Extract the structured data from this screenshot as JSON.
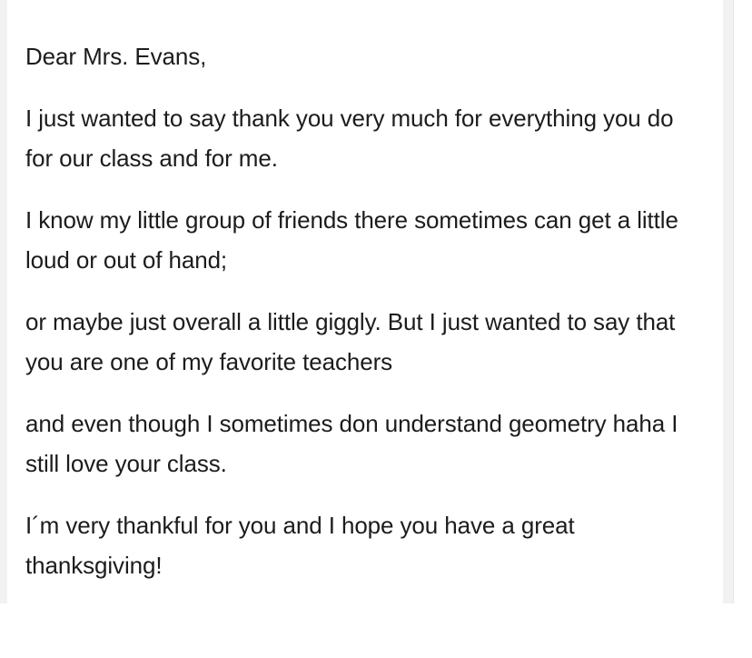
{
  "letter": {
    "paragraphs": [
      "Dear Mrs. Evans,",
      "I just wanted to say thank you very much for everything you do for our class and for me.",
      "I know my little group of friends there sometimes can get a little loud or out of hand;",
      "or maybe just overall a little giggly. But I just wanted to say that you are one of my favorite teachers",
      "and even though I sometimes don understand geometry haha I still love your class.",
      "I´m very thankful for you and I hope you have a great thanksgiving!"
    ]
  },
  "colors": {
    "text": "#1c1c1c",
    "card_background": "#ffffff",
    "page_background": "#f2f2f2"
  }
}
